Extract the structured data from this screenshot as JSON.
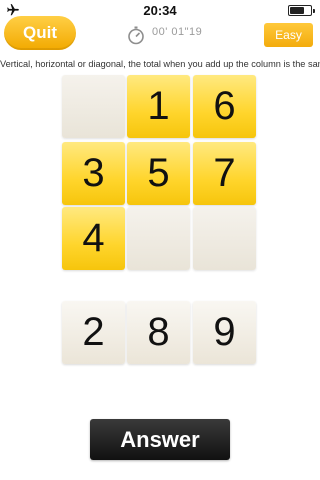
{
  "status_bar": {
    "time": "20:34",
    "airplane_icon": "airplane-icon",
    "battery_icon": "battery-icon",
    "battery_level": 0.7
  },
  "header": {
    "quit_label": "Quit",
    "timer_icon": "stopwatch-icon",
    "timer_text": "00' 01\"19",
    "level_label": "Easy"
  },
  "instruction": "Vertical, horizontal or diagonal, the total when you add up the column is the same.",
  "grid": {
    "cells": [
      "",
      "1",
      "6",
      "3",
      "5",
      "7",
      "4",
      "",
      ""
    ]
  },
  "choices": [
    "2",
    "8",
    "9"
  ],
  "answer_label": "Answer",
  "colors": {
    "accent_yellow": "#ffd52c",
    "quit_orange": "#f2a900",
    "answer_dark": "#111111",
    "empty_tile": "#ede8de"
  }
}
